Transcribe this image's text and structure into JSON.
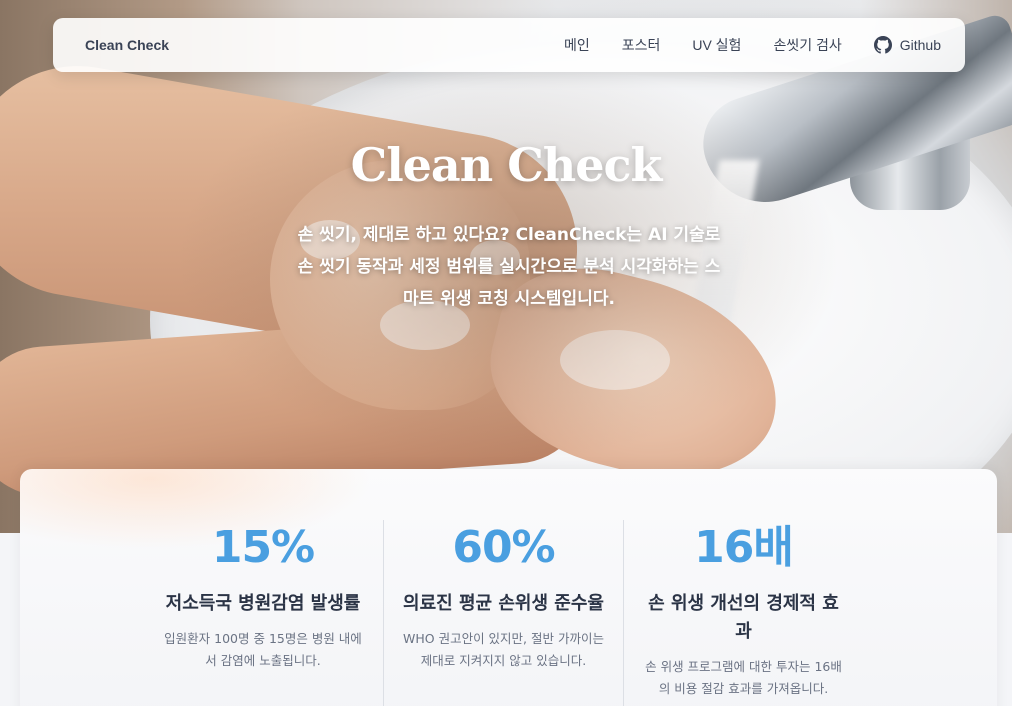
{
  "nav": {
    "brand": "Clean Check",
    "links": [
      "메인",
      "포스터",
      "UV 실험",
      "손씻기 검사"
    ],
    "github_label": "Github"
  },
  "hero": {
    "title": "Clean Check",
    "description": "손 씻기, 제대로 하고 있다요? CleanCheck는 AI 기술로 손 씻기 동작과 세정 범위를 실시간으로 분석 시각화하는 스마트 위생 코칭 시스템입니다."
  },
  "stats": [
    {
      "value": "15%",
      "title": "저소득국 병원감염 발생률",
      "desc": "입원환자 100명 중 15명은 병원 내에서 감염에 노출됩니다."
    },
    {
      "value": "60%",
      "title": "의료진 평균 손위생 준수율",
      "desc": "WHO 권고안이 있지만, 절반 가까이는 제대로 지켜지지 않고 있습니다."
    },
    {
      "value": "16배",
      "title": "손 위생 개선의 경제적 효과",
      "desc": "손 위생 프로그램에 대한 투자는 16배의 비용 절감 효과를 가져옵니다."
    }
  ],
  "colors": {
    "accent": "#4a9fe0",
    "text_dark": "#2b3446",
    "text_muted": "#6b7384"
  }
}
